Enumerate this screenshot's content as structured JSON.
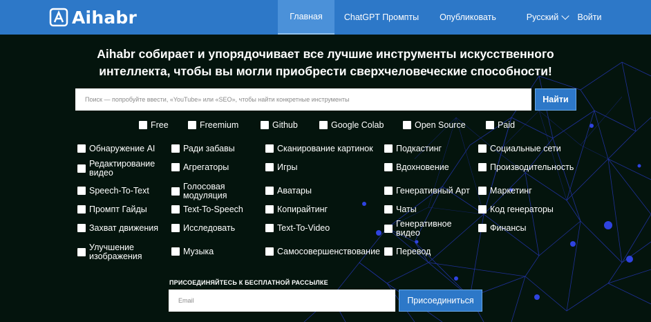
{
  "header": {
    "logo_text": "Aihabr",
    "nav": {
      "home": "Главная",
      "chatgpt": "ChatGPT Промпты",
      "publish": "Опубликовать",
      "language": "Русский",
      "login": "Войти"
    }
  },
  "hero": {
    "headline_line1": "Aihabr собирает и упорядочивает все лучшие инструменты искусственного",
    "headline_line2": "интеллекта, чтобы вы могли приобрести сверхчеловеческие способности!"
  },
  "search": {
    "placeholder": "Поиск — попробуйте ввести, «YouTube» или «SEO», чтобы найти конкретные инструменты",
    "button": "Найти"
  },
  "pricing_filters": [
    "Free",
    "Freemium",
    "Github",
    "Google Colab",
    "Open Source",
    "Paid"
  ],
  "categories": [
    [
      "Обнаружение AI",
      "Ради забавы",
      "Сканирование картинок",
      "Подкастинг",
      "Социальные сети"
    ],
    [
      "Редактирование видео",
      "Агрегаторы",
      "Игры",
      "Вдохновение",
      "Производительность"
    ],
    [
      "Speech-To-Text",
      "Голосовая модуляция",
      "Аватары",
      "Генеративный Арт",
      "Маркетинг"
    ],
    [
      "Промпт Гайды",
      "Text-To-Speech",
      "Копирайтинг",
      "Чаты",
      "Код генераторы"
    ],
    [
      "Захват движения",
      "Исследовать",
      "Text-To-Video",
      "Генеративное видео",
      "Финансы"
    ],
    [
      "Улучшение изображения",
      "Музыка",
      "Самосовершенствование",
      "Перевод",
      ""
    ]
  ],
  "newsletter": {
    "title": "ПРИСОЕДИНЯЙТЕСЬ К БЕСПЛАТНОЙ РАССЫЛКЕ",
    "email_placeholder": "Email",
    "button": "Присоединиться"
  },
  "colors": {
    "nav_bg": "#2d78c8",
    "page_bg": "#04140d",
    "accent_button": "#2d78c8",
    "network_lines": "#2a3fbf"
  }
}
